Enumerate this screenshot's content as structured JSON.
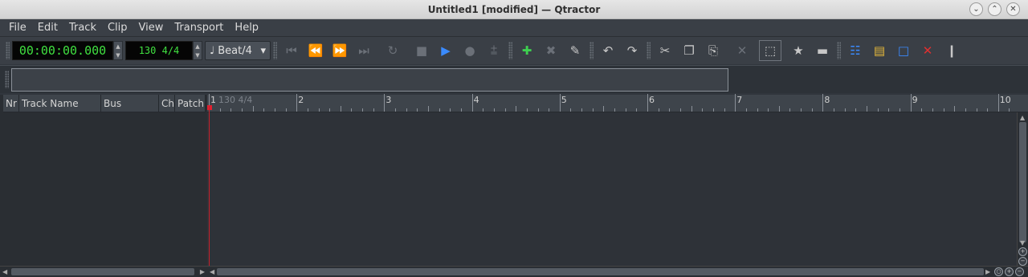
{
  "window": {
    "title": "Untitled1 [modified] — Qtractor",
    "controls": [
      "⌄",
      "⌃",
      "✕"
    ]
  },
  "menu": [
    {
      "label": "File"
    },
    {
      "label": "Edit"
    },
    {
      "label": "Track"
    },
    {
      "label": "Clip"
    },
    {
      "label": "View"
    },
    {
      "label": "Transport"
    },
    {
      "label": "Help"
    }
  ],
  "toolbar": {
    "time": "00:00:00.000",
    "tempo": "130 4/4",
    "snap": "♩ Beat/4",
    "spin_up": "▲",
    "spin_down": "▼",
    "combo_arrow": "▾"
  },
  "icons": {
    "first": "⏮",
    "rewind": "⏪",
    "forward": "⏩",
    "last": "⏭",
    "loop": "↻",
    "stop": "■",
    "play": "▶",
    "record": "●",
    "punch": "⩲",
    "add_track": "✚",
    "remove_track": "✖",
    "edit_track": "✎",
    "undo": "↶",
    "redo": "↷",
    "cut": "✂",
    "copy": "❐",
    "paste": "⎘",
    "delete": "✕",
    "select": "⬚",
    "clip_a": "★",
    "clip_b": "▬",
    "connections": "☷",
    "files": "▤",
    "box": "□",
    "split": "✕",
    "mixer": "❙"
  },
  "tracklist": {
    "headers": [
      "Nr",
      "Track Name",
      "Bus",
      "Ch",
      "Patch"
    ]
  },
  "ruler": {
    "tempo_marker": "130 4/4",
    "bars": [
      "1",
      "2",
      "3",
      "4",
      "5",
      "6",
      "7",
      "8",
      "9",
      "10"
    ]
  },
  "scroll": {
    "left": "◀",
    "right": "▶",
    "up": "▲",
    "down": "▼",
    "zoom_in": "+",
    "zoom_out": "−",
    "zoom_reset": "○"
  },
  "colors": {
    "lcd_text": "#40e040",
    "playhead": "#c8202a",
    "accent_blue": "#3a8bff"
  }
}
